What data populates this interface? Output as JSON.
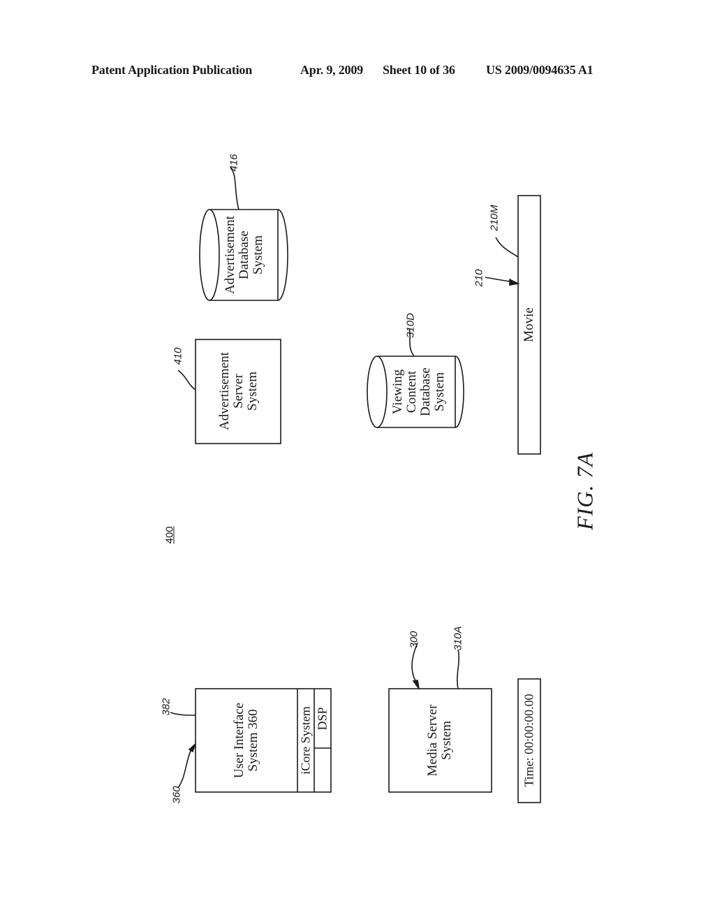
{
  "header": {
    "publication": "Patent Application Publication",
    "date": "Apr. 9, 2009",
    "sheet": "Sheet 10 of 36",
    "patent_number": "US 2009/0094635 A1"
  },
  "figure": {
    "caption": "FIG.  7A",
    "system_ref": "400"
  },
  "components": {
    "user_interface": {
      "line1": "User Interface",
      "line2": "System  360",
      "ref": "360",
      "ref2": "382"
    },
    "icore": {
      "label": "iCore System"
    },
    "dsp": {
      "label": "DSP"
    },
    "media_server": {
      "line1": "Media Server",
      "line2": "System",
      "ref": "300",
      "ref2": "310A"
    },
    "time_display": {
      "label": "Time:  00:00:00.00"
    },
    "ad_server": {
      "line1": "Advertisement",
      "line2": "Server",
      "line3": "System",
      "ref": "410"
    },
    "ad_database": {
      "line1": "Advertisement",
      "line2": "Database",
      "line3": "System",
      "ref": "416"
    },
    "viewing_database": {
      "line1": "Viewing",
      "line2": "Content",
      "line3": "Database",
      "line4": "System",
      "ref": "310D"
    },
    "movie": {
      "label": "Movie",
      "ref": "210",
      "ref2": "210M"
    }
  }
}
